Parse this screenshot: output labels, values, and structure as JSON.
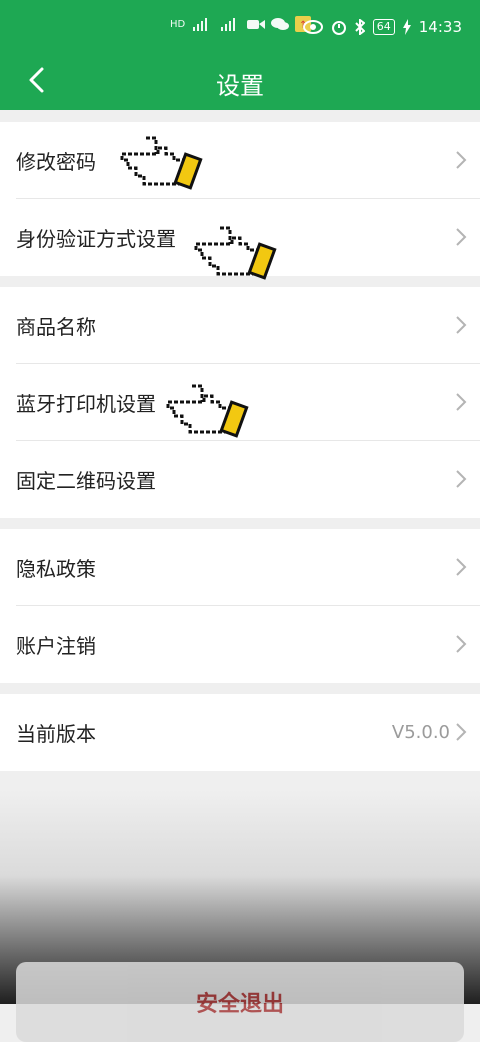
{
  "status_bar": {
    "time": "14:33",
    "battery": "64",
    "icons": [
      "hd-icon",
      "signal-icon",
      "signal-icon",
      "video-icon",
      "wechat-icon",
      "app-icon",
      "eye-icon",
      "alarm-icon",
      "bluetooth-icon",
      "battery-icon",
      "charging-icon"
    ]
  },
  "header": {
    "title": "设置",
    "back_icon": "chevron-left-icon"
  },
  "groups": [
    {
      "items": [
        {
          "label": "修改密码"
        },
        {
          "label": "身份验证方式设置"
        }
      ]
    },
    {
      "items": [
        {
          "label": "商品名称"
        },
        {
          "label": "蓝牙打印机设置"
        },
        {
          "label": "固定二维码设置"
        }
      ]
    },
    {
      "items": [
        {
          "label": "隐私政策"
        },
        {
          "label": "账户注销"
        }
      ]
    },
    {
      "items": [
        {
          "label": "当前版本",
          "value": "V5.0.0"
        }
      ]
    }
  ],
  "footer": {
    "logout_label": "安全退出"
  },
  "colors": {
    "primary": "#1ea853",
    "background": "#efefef",
    "logout_text": "#a53a3a"
  },
  "annotation_icons": [
    "pointing-hand-icon"
  ]
}
